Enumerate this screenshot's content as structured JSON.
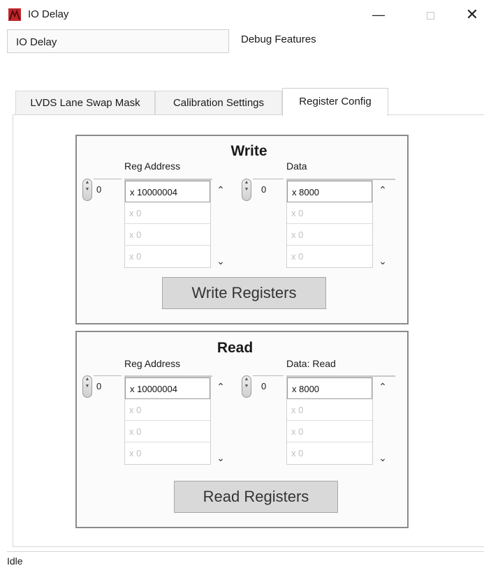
{
  "window": {
    "title": "IO Delay",
    "icon": "app-logo-icon",
    "controls": {
      "minimize": "—",
      "maximize": "",
      "close": "✕"
    }
  },
  "header": {
    "name_field_value": "IO Delay",
    "debug_label": "Debug Features"
  },
  "tabs": [
    {
      "label": "LVDS Lane Swap Mask",
      "active": false
    },
    {
      "label": "Calibration Settings",
      "active": false
    },
    {
      "label": "Register Config",
      "active": true
    }
  ],
  "write_group": {
    "title": "Write",
    "addr_label": "Reg Address",
    "data_label": "Data",
    "addr_index": "0",
    "data_index": "0",
    "addr_values": [
      "x 10000004",
      "x 0",
      "x 0",
      "x 0"
    ],
    "data_values": [
      "x 8000",
      "x 0",
      "x 0",
      "x 0"
    ],
    "button_label": "Write Registers"
  },
  "read_group": {
    "title": "Read",
    "addr_label": "Reg Address",
    "data_label": "Data: Read",
    "addr_index": "0",
    "data_index": "0",
    "addr_values": [
      "x 10000004",
      "x 0",
      "x 0",
      "x 0"
    ],
    "data_values": [
      "x 8000",
      "x 0",
      "x 0",
      "x 0"
    ],
    "button_label": "Read Registers"
  },
  "status": {
    "text": "Idle"
  },
  "colors": {
    "icon_red": "#c0262d",
    "button_gray": "#d9d9d9",
    "group_border": "#8a8a8a"
  }
}
